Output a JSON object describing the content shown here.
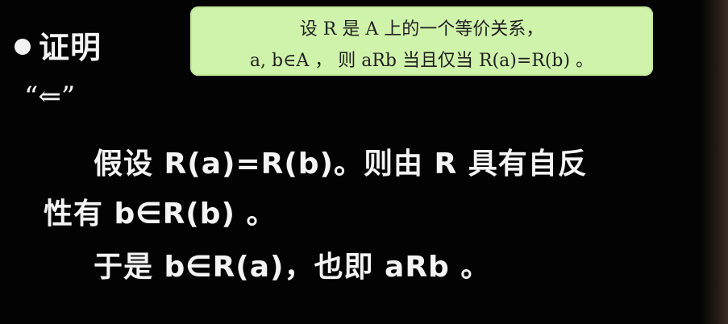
{
  "bullet_title": "证明",
  "direction": "“⇐”",
  "callout": {
    "line1": "设 R 是 A 上的一个等价关系，",
    "line2": "a, b∈A ， 则 aRb 当且仅当 R(a)=R(b) 。"
  },
  "proof_lines": [
    "假设 R(a)=R(b)。则由 R 具有自反",
    "性有 b∈R(b) 。",
    "于是 b∈R(a)，也即 aRb 。"
  ]
}
